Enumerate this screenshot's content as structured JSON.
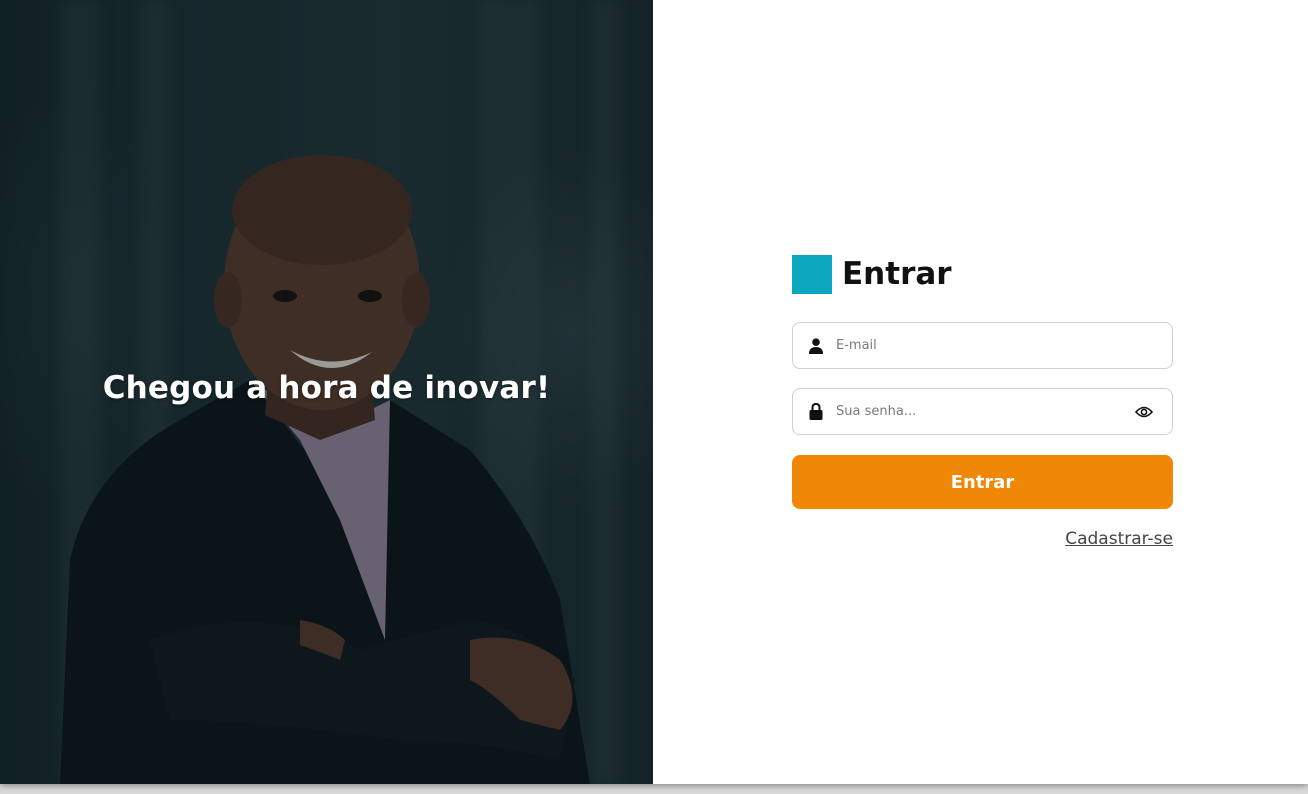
{
  "hero": {
    "headline": "Chegou a hora de inovar!"
  },
  "login": {
    "title": "Entrar",
    "email": {
      "placeholder": "E-mail",
      "value": "",
      "icon": "user-icon"
    },
    "password": {
      "placeholder": "Sua senha...",
      "value": "",
      "icon": "lock-icon",
      "toggle_icon": "eye-icon"
    },
    "submit_label": "Entrar",
    "signup_label": "Cadastrar-se"
  },
  "colors": {
    "brand": "#0aa7bf",
    "accent": "#f08705"
  }
}
